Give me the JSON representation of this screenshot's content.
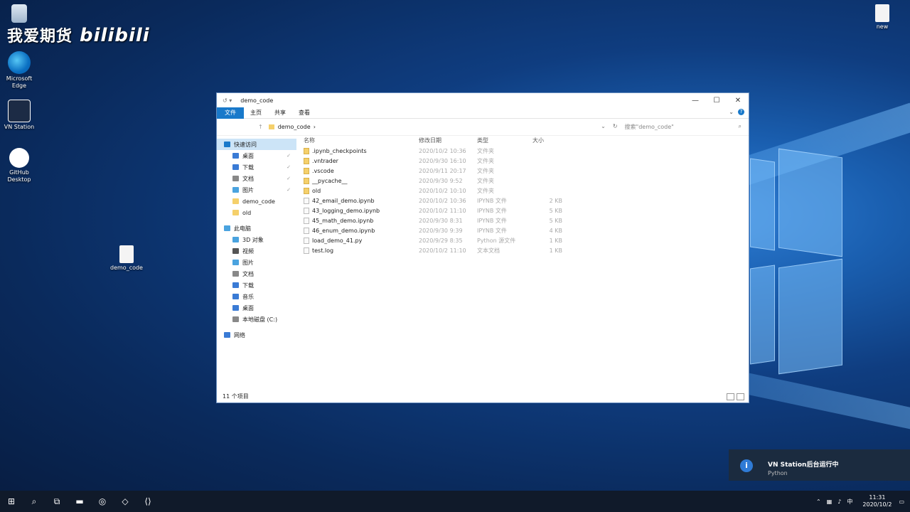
{
  "watermark": {
    "text": "我爱期货",
    "logo": "bilibili"
  },
  "desktop": {
    "icons": [
      {
        "label": "Microsoft Edge",
        "icon": "edge-icon"
      },
      {
        "label": "VN Station",
        "icon": "vnstation-icon"
      },
      {
        "label": "GitHub Desktop",
        "icon": "github-icon"
      },
      {
        "label": "demo_code",
        "icon": "file-icon"
      },
      {
        "label": "new",
        "icon": "file-icon"
      }
    ]
  },
  "explorer": {
    "title": "demo_code",
    "quick_access": "↺ ▾",
    "controls": {
      "minimize": "—",
      "maximize": "☐",
      "close": "✕"
    },
    "ribbon_tabs": [
      "文件",
      "主页",
      "共享",
      "查看"
    ],
    "address": {
      "segments": [
        "demo_code",
        "›"
      ],
      "search_placeholder": "搜索\"demo_code\""
    },
    "sidebar": [
      {
        "label": "快速访问",
        "color": "#1979ca",
        "selected": true
      },
      {
        "label": "桌面",
        "color": "#3a7bd5",
        "sub": true,
        "pin": true
      },
      {
        "label": "下载",
        "color": "#3a7bd5",
        "sub": true,
        "pin": true
      },
      {
        "label": "文档",
        "color": "#888888",
        "sub": true,
        "pin": true
      },
      {
        "label": "图片",
        "color": "#4aa3df",
        "sub": true,
        "pin": true
      },
      {
        "label": "demo_code",
        "color": "#f5d06b",
        "sub": true
      },
      {
        "label": "old",
        "color": "#f5d06b",
        "sub": true
      },
      {
        "label": "此电脑",
        "color": "#4aa3df"
      },
      {
        "label": "3D 对象",
        "color": "#4aa3df",
        "sub": true
      },
      {
        "label": "视频",
        "color": "#555555",
        "sub": true
      },
      {
        "label": "图片",
        "color": "#4aa3df",
        "sub": true
      },
      {
        "label": "文档",
        "color": "#888888",
        "sub": true
      },
      {
        "label": "下载",
        "color": "#3a7bd5",
        "sub": true
      },
      {
        "label": "音乐",
        "color": "#3a7bd5",
        "sub": true
      },
      {
        "label": "桌面",
        "color": "#3a7bd5",
        "sub": true
      },
      {
        "label": "本地磁盘 (C:)",
        "color": "#888888",
        "sub": true
      },
      {
        "label": "网络",
        "color": "#3a7bd5"
      }
    ],
    "columns": [
      "名称",
      "修改日期",
      "类型",
      "大小"
    ],
    "files": [
      {
        "name": ".ipynb_checkpoints",
        "date": "2020/10/2 10:36",
        "type": "文件夹",
        "size": "",
        "folder": true
      },
      {
        "name": ".vntrader",
        "date": "2020/9/30 16:10",
        "type": "文件夹",
        "size": "",
        "folder": true
      },
      {
        "name": ".vscode",
        "date": "2020/9/11 20:17",
        "type": "文件夹",
        "size": "",
        "folder": true
      },
      {
        "name": "__pycache__",
        "date": "2020/9/30 9:52",
        "type": "文件夹",
        "size": "",
        "folder": true
      },
      {
        "name": "old",
        "date": "2020/10/2 10:10",
        "type": "文件夹",
        "size": "",
        "folder": true
      },
      {
        "name": "42_email_demo.ipynb",
        "date": "2020/10/2 10:36",
        "type": "IPYNB 文件",
        "size": "2 KB",
        "folder": false
      },
      {
        "name": "43_logging_demo.ipynb",
        "date": "2020/10/2 11:10",
        "type": "IPYNB 文件",
        "size": "5 KB",
        "folder": false
      },
      {
        "name": "45_math_demo.ipynb",
        "date": "2020/9/30 8:31",
        "type": "IPYNB 文件",
        "size": "5 KB",
        "folder": false
      },
      {
        "name": "46_enum_demo.ipynb",
        "date": "2020/9/30 9:39",
        "type": "IPYNB 文件",
        "size": "4 KB",
        "folder": false
      },
      {
        "name": "load_demo_41.py",
        "date": "2020/9/29 8:35",
        "type": "Python 源文件",
        "size": "1 KB",
        "folder": false
      },
      {
        "name": "test.log",
        "date": "2020/10/2 11:10",
        "type": "文本文档",
        "size": "1 KB",
        "folder": false
      }
    ],
    "status": "11 个项目"
  },
  "notification": {
    "title": "VN Station后台运行中",
    "subtitle": "Python",
    "icon": "info-icon"
  },
  "taskbar": {
    "items": [
      {
        "glyph": "⊞",
        "name": "start-icon"
      },
      {
        "glyph": "⌕",
        "name": "search-icon"
      },
      {
        "glyph": "⧉",
        "name": "task-view-icon"
      },
      {
        "glyph": "▬",
        "name": "explorer-taskbar-icon"
      },
      {
        "glyph": "◎",
        "name": "edge-taskbar-icon"
      },
      {
        "glyph": "◇",
        "name": "vnstation-taskbar-icon"
      },
      {
        "glyph": "⟨⟩",
        "name": "vscode-taskbar-icon"
      }
    ],
    "time": "11:31",
    "date": "2020/10/2"
  }
}
